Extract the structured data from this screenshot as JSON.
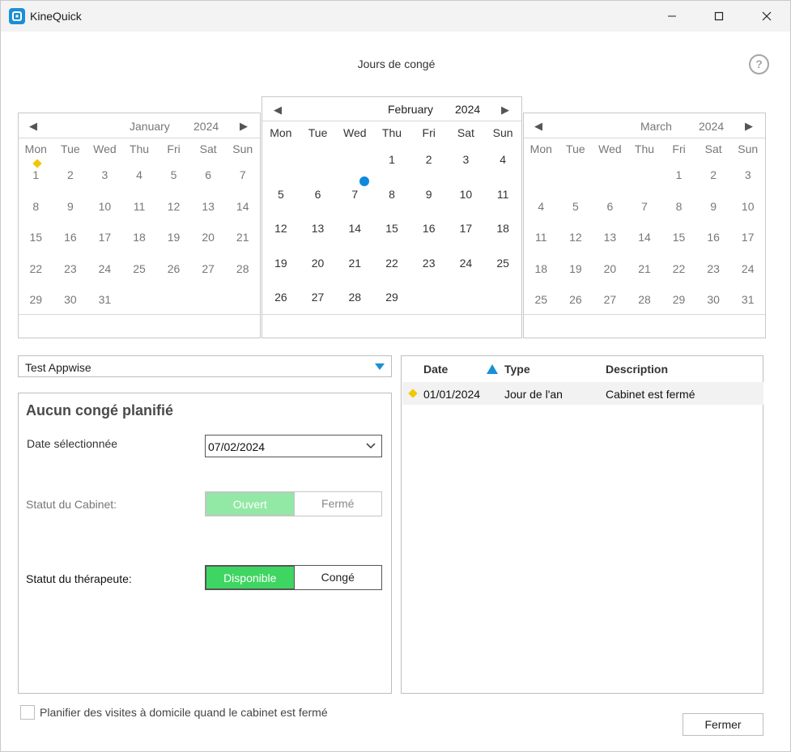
{
  "app": {
    "title": "KineQuick"
  },
  "page": {
    "title": "Jours de congé",
    "help": "?"
  },
  "calendar": {
    "arrows": {
      "prev": "◀",
      "next": "▶"
    },
    "weekdays": [
      "Mon",
      "Tue",
      "Wed",
      "Thu",
      "Fri",
      "Sat",
      "Sun"
    ],
    "months": [
      {
        "name": "January",
        "year": "2024",
        "offset": 0,
        "days": 31,
        "holidays": [
          1
        ],
        "selected": []
      },
      {
        "name": "February",
        "year": "2024",
        "offset": 3,
        "days": 29,
        "holidays": [],
        "selected": [
          7
        ]
      },
      {
        "name": "March",
        "year": "2024",
        "offset": 4,
        "days": 31,
        "holidays": [],
        "selected": []
      }
    ]
  },
  "therapist_select": {
    "value": "Test Appwise"
  },
  "panel": {
    "title": "Aucun congé planifié",
    "date_label": "Date sélectionnée",
    "date_value": "07/02/2024",
    "cabinet_label": "Statut du Cabinet:",
    "cabinet_on": "Ouvert",
    "cabinet_off": "Fermé",
    "therapist_label": "Statut du thérapeute:",
    "therapist_on": "Disponible",
    "therapist_off": "Congé"
  },
  "holiday_list": {
    "columns": {
      "date": "Date",
      "type": "Type",
      "description": "Description"
    },
    "rows": [
      {
        "date": "01/01/2024",
        "type": "Jour de l'an",
        "description": "Cabinet est fermé"
      }
    ]
  },
  "home_visits": {
    "label": "Planifier des visites à domicile quand le cabinet est fermé"
  },
  "buttons": {
    "close": "Fermer"
  },
  "colors": {
    "accent": "#1a8fd6",
    "holiday_marker": "#f1c800",
    "selected_marker": "#0f88e0",
    "green_on": "#3ed562",
    "green_on_light": "#92e8a5"
  }
}
